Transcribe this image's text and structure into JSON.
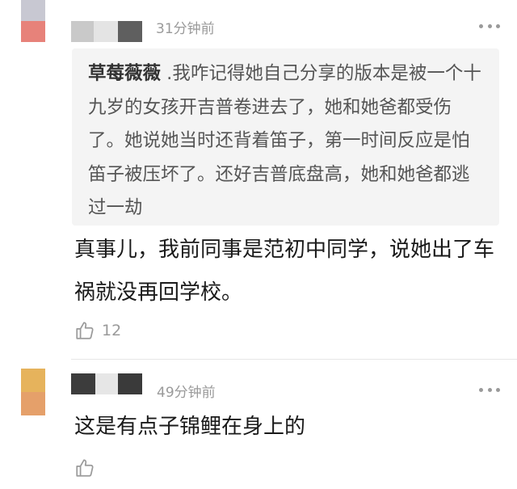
{
  "comments": [
    {
      "avatar_colors": [
        "#c8c8d2",
        "#e7827a"
      ],
      "name_blur_colors": [
        "#c9c9c9",
        "#e4e4e4",
        "#5f5f5f"
      ],
      "time": "31分钟前",
      "more_icon": "more-dots-icon",
      "quote": {
        "author": "草莓薇薇",
        "text": " .我咋记得她自己分享的版本是被一个十九岁的女孩开吉普卷进去了，她和她爸都受伤了。她说她当时还背着笛子，第一时间反应是怕笛子被压坏了。还好吉普底盘高，她和她爸都逃过一劫"
      },
      "text": "真事儿，我前同事是范初中同学，说她出了车祸就没再回学校。",
      "like_icon": "thumbs-up-icon",
      "likes": "12"
    },
    {
      "avatar_colors": [
        "#e6b35c",
        "#e5a06a"
      ],
      "name_blur_colors": [
        "#3c3c3c",
        "#e6e6e6",
        "#3a3a3a"
      ],
      "time": "49分钟前",
      "more_icon": "more-dots-icon",
      "text": "这是有点子锦鲤在身上的",
      "like_icon": "thumbs-up-icon",
      "likes": ""
    }
  ]
}
